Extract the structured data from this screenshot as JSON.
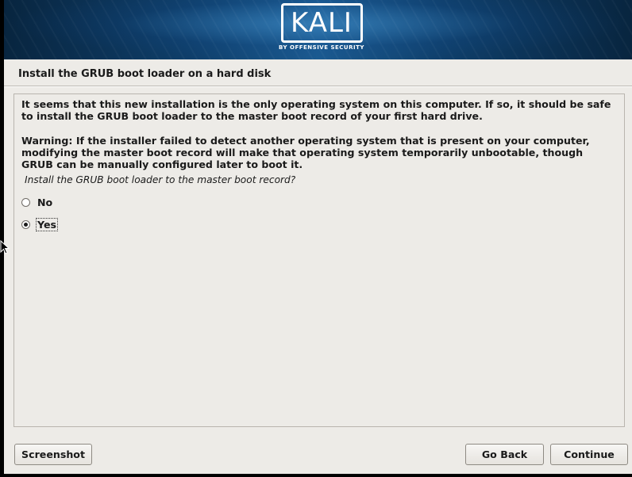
{
  "banner": {
    "logo_text": "KALI",
    "logo_subtitle": "BY OFFENSIVE SECURITY"
  },
  "page": {
    "title": "Install the GRUB boot loader on a hard disk"
  },
  "content": {
    "paragraph1": "It seems that this new installation is the only operating system on this computer. If so, it should be safe to install the GRUB boot loader to the master boot record of your first hard drive.",
    "paragraph2": "Warning: If the installer failed to detect another operating system that is present on your computer, modifying the master boot record will make that operating system temporarily unbootable, though GRUB can be manually configured later to boot it.",
    "question": "Install the GRUB boot loader to the master boot record?"
  },
  "options": [
    {
      "label": "No",
      "selected": false
    },
    {
      "label": "Yes",
      "selected": true
    }
  ],
  "buttons": {
    "screenshot": "Screenshot",
    "go_back": "Go Back",
    "continue": "Continue"
  },
  "colors": {
    "background": "#edebe7",
    "banner": "#0f3f6b"
  }
}
